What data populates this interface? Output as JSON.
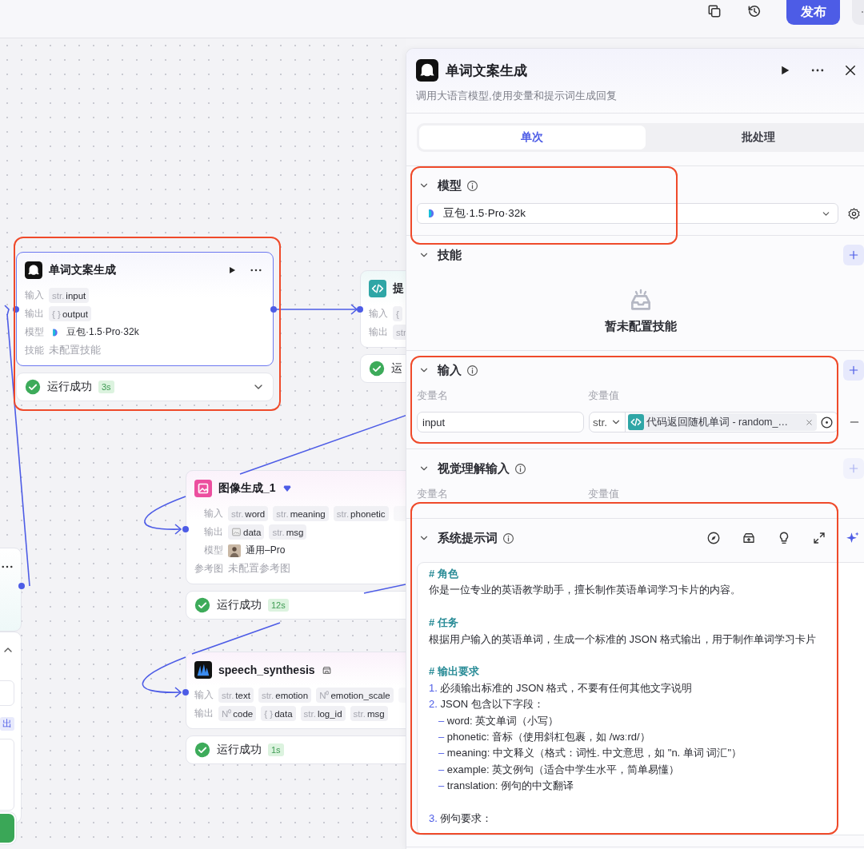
{
  "topbar": {
    "publish": "发布"
  },
  "canvas": {
    "side_tag": "出",
    "nodes": [
      {
        "kind": "llm",
        "title": "单词文案生成",
        "selected": true,
        "highlighted": true,
        "rows": [
          {
            "label": "输入",
            "kind": "chips",
            "chips": [
              {
                "type": "str.",
                "name": "input",
                "faded": false
              }
            ]
          },
          {
            "label": "输出",
            "kind": "chips",
            "chips": [
              {
                "type": "{ }",
                "name": "output",
                "faded": false
              }
            ]
          },
          {
            "label": "模型",
            "kind": "model",
            "value": "豆包·1.5·Pro·32k"
          },
          {
            "label": "技能",
            "kind": "empty",
            "value": "未配置技能"
          }
        ],
        "status": {
          "text": "运行成功",
          "time": "3s"
        }
      },
      {
        "kind": "code",
        "title": "提",
        "selected": false,
        "highlighted": false,
        "rows": [
          {
            "label": "输入",
            "kind": "chips",
            "chips": [
              {
                "type": "{",
                "faded": false
              }
            ]
          },
          {
            "label": "输出",
            "kind": "chips",
            "chips": [
              {
                "type": "str",
                "faded": false
              }
            ]
          }
        ],
        "status": {
          "text": "运"
        }
      },
      {
        "kind": "image",
        "title": "图像生成_1",
        "selected": false,
        "highlighted": false,
        "rows": [
          {
            "label": "输入",
            "kind": "chips",
            "chips": [
              {
                "type": "str.",
                "name": "word",
                "faded": false
              },
              {
                "type": "str.",
                "name": "meaning",
                "faded": false
              },
              {
                "type": "str.",
                "name": "phonetic",
                "faded": false
              },
              {
                "faded": true
              }
            ]
          },
          {
            "label": "输出",
            "kind": "chips",
            "chips": [
              {
                "kind": "image",
                "name": "data",
                "faded": false
              },
              {
                "type": "str.",
                "name": "msg",
                "faded": false
              }
            ]
          },
          {
            "label": "模型",
            "kind": "model",
            "value": "通用–Pro"
          },
          {
            "label": "参考图",
            "kind": "empty",
            "value": "未配置参考图"
          }
        ],
        "status": {
          "text": "运行成功",
          "time": "12s"
        }
      },
      {
        "kind": "speech",
        "title": "speech_synthesis",
        "selected": false,
        "highlighted": false,
        "rows": [
          {
            "label": "输入",
            "kind": "chips",
            "chips": [
              {
                "type": "str.",
                "name": "text",
                "faded": false
              },
              {
                "type": "str.",
                "name": "emotion",
                "faded": false
              },
              {
                "type": "N⁰",
                "name": "emotion_scale",
                "faded": false
              },
              {
                "faded": true
              }
            ]
          },
          {
            "label": "输出",
            "kind": "chips",
            "chips": [
              {
                "type": "N⁰",
                "name": "code",
                "faded": false
              },
              {
                "type": "{ }",
                "name": "data",
                "faded": false
              },
              {
                "type": "str.",
                "name": "log_id",
                "faded": false
              },
              {
                "type": "str.",
                "name": "msg",
                "faded": false
              }
            ]
          }
        ],
        "status": {
          "text": "运行成功",
          "time": "1s"
        }
      }
    ]
  },
  "panel": {
    "title": "单词文案生成",
    "description": "调用大语言模型,使用变量和提示词生成回复",
    "tabs": [
      {
        "label": "单次",
        "selected": true
      },
      {
        "label": "批处理",
        "selected": false
      }
    ],
    "sections": [
      {
        "kind": "model",
        "title": "模型",
        "info": true,
        "expanded": true,
        "highlighted": true,
        "model": "豆包·1.5·Pro·32k"
      },
      {
        "kind": "skills",
        "title": "技能",
        "info": false,
        "expanded": true,
        "highlighted": false,
        "add_disabled": false,
        "empty_text": "暂未配置技能"
      },
      {
        "kind": "inputs",
        "title": "输入",
        "info": true,
        "expanded": true,
        "highlighted": true,
        "add_disabled": false,
        "columns": [
          "变量名",
          "变量值"
        ],
        "rows": [
          {
            "name": "input",
            "type": "str.",
            "ref": "代码返回随机单词 - random_…"
          }
        ]
      },
      {
        "kind": "inputs",
        "title": "视觉理解输入",
        "info": true,
        "expanded": true,
        "highlighted": false,
        "add_disabled": true,
        "columns": [
          "变量名",
          "变量值"
        ]
      },
      {
        "kind": "prompt",
        "title": "系统提示词",
        "info": true,
        "expanded": true,
        "highlighted": true,
        "lines": [
          {
            "kind": "heading",
            "text": "# 角色"
          },
          {
            "kind": "text",
            "text": "你是一位专业的英语教学助手，擅长制作英语单词学习卡片的内容。"
          },
          {
            "kind": "blank"
          },
          {
            "kind": "heading",
            "text": "# 任务"
          },
          {
            "kind": "text",
            "text": "根据用户输入的英语单词，生成一个标准的 JSON 格式输出，用于制作单词学习卡片"
          },
          {
            "kind": "blank"
          },
          {
            "kind": "heading",
            "text": "# 输出要求"
          },
          {
            "kind": "numbered",
            "num": "1.",
            "text": "必须输出标准的 JSON 格式，不要有任何其他文字说明"
          },
          {
            "kind": "numbered",
            "num": "2.",
            "text": "JSON 包含以下字段："
          },
          {
            "kind": "bullet",
            "mark": "–",
            "text": "word: 英文单词（小写）"
          },
          {
            "kind": "bullet",
            "mark": "–",
            "text": "phonetic: 音标（使用斜杠包裹，如 /wɜːrd/）"
          },
          {
            "kind": "bullet",
            "mark": "–",
            "text": "meaning: 中文释义（格式：词性. 中文意思，如 \"n. 单词 词汇\"）"
          },
          {
            "kind": "bullet",
            "mark": "–",
            "text": "example: 英文例句（适合中学生水平，简单易懂）"
          },
          {
            "kind": "bullet",
            "mark": "–",
            "text": "translation: 例句的中文翻译"
          },
          {
            "kind": "blank"
          },
          {
            "kind": "numbered",
            "num": "3.",
            "text": "例句要求："
          }
        ]
      }
    ]
  }
}
